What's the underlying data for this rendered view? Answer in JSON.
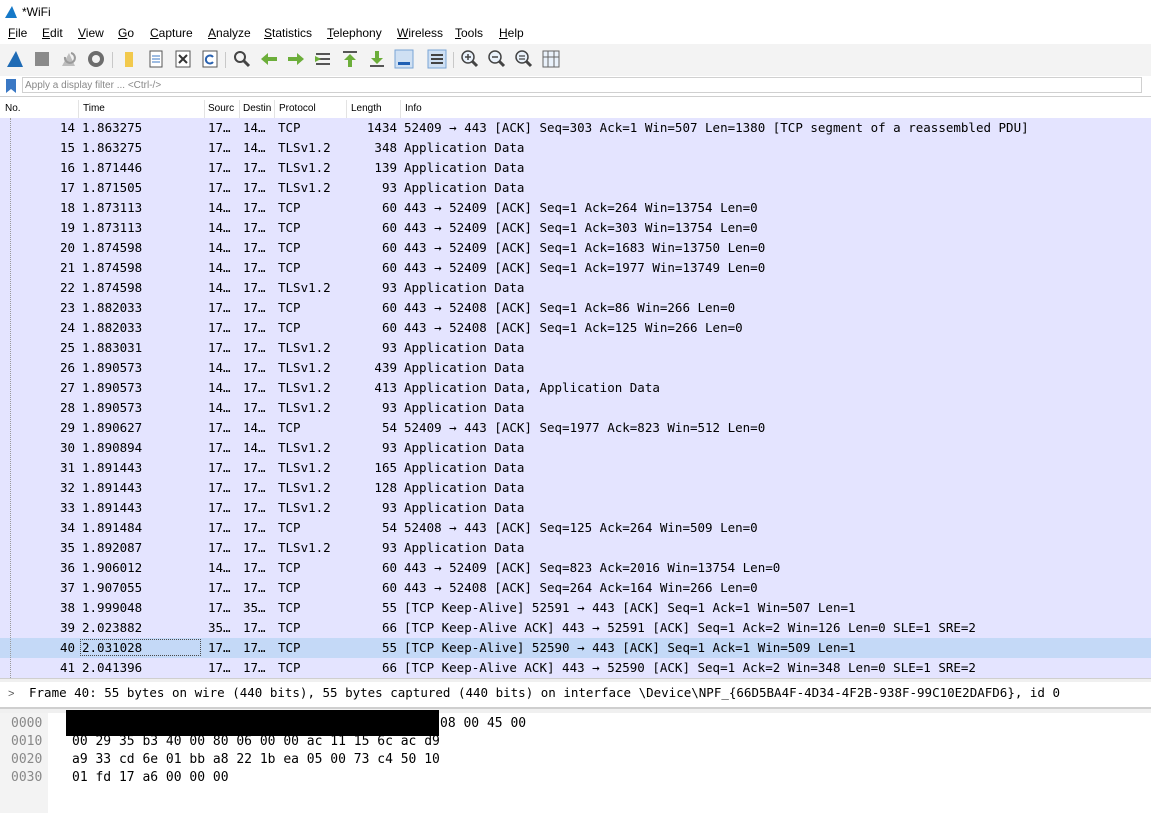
{
  "window": {
    "title": "*WiFi"
  },
  "menu": [
    "File",
    "Edit",
    "View",
    "Go",
    "Capture",
    "Analyze",
    "Statistics",
    "Telephony",
    "Wireless",
    "Tools",
    "Help"
  ],
  "toolbar_icons": [
    "shark-fin-start-icon",
    "stop-capture-icon",
    "restart-capture-icon",
    "capture-options-icon",
    "open-file-icon",
    "save-file-icon",
    "close-file-icon",
    "reload-file-icon",
    "find-packet-icon",
    "go-back-icon",
    "go-forward-icon",
    "go-to-packet-icon",
    "go-first-icon",
    "go-last-icon",
    "autoscroll-icon",
    "colorize-icon",
    "zoom-in-icon",
    "zoom-out-icon",
    "zoom-normal-icon",
    "resize-columns-icon"
  ],
  "filter": {
    "placeholder": "Apply a display filter ... <Ctrl-/>"
  },
  "columns": [
    "No.",
    "Time",
    "Sourc",
    "Destin",
    "Protocol",
    "Length",
    "Info"
  ],
  "packets": [
    {
      "no": "14",
      "time": "1.863275",
      "src": "17…",
      "dst": "14…",
      "proto": "TCP",
      "len": "1434",
      "info": "52409 → 443 [ACK] Seq=303 Ack=1 Win=507 Len=1380 [TCP segment of a reassembled PDU]"
    },
    {
      "no": "15",
      "time": "1.863275",
      "src": "17…",
      "dst": "14…",
      "proto": "TLSv1.2",
      "len": "348",
      "info": "Application Data"
    },
    {
      "no": "16",
      "time": "1.871446",
      "src": "17…",
      "dst": "17…",
      "proto": "TLSv1.2",
      "len": "139",
      "info": "Application Data"
    },
    {
      "no": "17",
      "time": "1.871505",
      "src": "17…",
      "dst": "17…",
      "proto": "TLSv1.2",
      "len": "93",
      "info": "Application Data"
    },
    {
      "no": "18",
      "time": "1.873113",
      "src": "14…",
      "dst": "17…",
      "proto": "TCP",
      "len": "60",
      "info": "443 → 52409 [ACK] Seq=1 Ack=264 Win=13754 Len=0"
    },
    {
      "no": "19",
      "time": "1.873113",
      "src": "14…",
      "dst": "17…",
      "proto": "TCP",
      "len": "60",
      "info": "443 → 52409 [ACK] Seq=1 Ack=303 Win=13754 Len=0"
    },
    {
      "no": "20",
      "time": "1.874598",
      "src": "14…",
      "dst": "17…",
      "proto": "TCP",
      "len": "60",
      "info": "443 → 52409 [ACK] Seq=1 Ack=1683 Win=13750 Len=0"
    },
    {
      "no": "21",
      "time": "1.874598",
      "src": "14…",
      "dst": "17…",
      "proto": "TCP",
      "len": "60",
      "info": "443 → 52409 [ACK] Seq=1 Ack=1977 Win=13749 Len=0"
    },
    {
      "no": "22",
      "time": "1.874598",
      "src": "14…",
      "dst": "17…",
      "proto": "TLSv1.2",
      "len": "93",
      "info": "Application Data"
    },
    {
      "no": "23",
      "time": "1.882033",
      "src": "17…",
      "dst": "17…",
      "proto": "TCP",
      "len": "60",
      "info": "443 → 52408 [ACK] Seq=1 Ack=86 Win=266 Len=0"
    },
    {
      "no": "24",
      "time": "1.882033",
      "src": "17…",
      "dst": "17…",
      "proto": "TCP",
      "len": "60",
      "info": "443 → 52408 [ACK] Seq=1 Ack=125 Win=266 Len=0"
    },
    {
      "no": "25",
      "time": "1.883031",
      "src": "17…",
      "dst": "17…",
      "proto": "TLSv1.2",
      "len": "93",
      "info": "Application Data"
    },
    {
      "no": "26",
      "time": "1.890573",
      "src": "14…",
      "dst": "17…",
      "proto": "TLSv1.2",
      "len": "439",
      "info": "Application Data"
    },
    {
      "no": "27",
      "time": "1.890573",
      "src": "14…",
      "dst": "17…",
      "proto": "TLSv1.2",
      "len": "413",
      "info": "Application Data, Application Data"
    },
    {
      "no": "28",
      "time": "1.890573",
      "src": "14…",
      "dst": "17…",
      "proto": "TLSv1.2",
      "len": "93",
      "info": "Application Data"
    },
    {
      "no": "29",
      "time": "1.890627",
      "src": "17…",
      "dst": "14…",
      "proto": "TCP",
      "len": "54",
      "info": "52409 → 443 [ACK] Seq=1977 Ack=823 Win=512 Len=0"
    },
    {
      "no": "30",
      "time": "1.890894",
      "src": "17…",
      "dst": "14…",
      "proto": "TLSv1.2",
      "len": "93",
      "info": "Application Data"
    },
    {
      "no": "31",
      "time": "1.891443",
      "src": "17…",
      "dst": "17…",
      "proto": "TLSv1.2",
      "len": "165",
      "info": "Application Data"
    },
    {
      "no": "32",
      "time": "1.891443",
      "src": "17…",
      "dst": "17…",
      "proto": "TLSv1.2",
      "len": "128",
      "info": "Application Data"
    },
    {
      "no": "33",
      "time": "1.891443",
      "src": "17…",
      "dst": "17…",
      "proto": "TLSv1.2",
      "len": "93",
      "info": "Application Data"
    },
    {
      "no": "34",
      "time": "1.891484",
      "src": "17…",
      "dst": "17…",
      "proto": "TCP",
      "len": "54",
      "info": "52408 → 443 [ACK] Seq=125 Ack=264 Win=509 Len=0"
    },
    {
      "no": "35",
      "time": "1.892087",
      "src": "17…",
      "dst": "17…",
      "proto": "TLSv1.2",
      "len": "93",
      "info": "Application Data"
    },
    {
      "no": "36",
      "time": "1.906012",
      "src": "14…",
      "dst": "17…",
      "proto": "TCP",
      "len": "60",
      "info": "443 → 52409 [ACK] Seq=823 Ack=2016 Win=13754 Len=0"
    },
    {
      "no": "37",
      "time": "1.907055",
      "src": "17…",
      "dst": "17…",
      "proto": "TCP",
      "len": "60",
      "info": "443 → 52408 [ACK] Seq=264 Ack=164 Win=266 Len=0"
    },
    {
      "no": "38",
      "time": "1.999048",
      "src": "17…",
      "dst": "35…",
      "proto": "TCP",
      "len": "55",
      "info": "[TCP Keep-Alive] 52591 → 443 [ACK] Seq=1 Ack=1 Win=507 Len=1"
    },
    {
      "no": "39",
      "time": "2.023882",
      "src": "35…",
      "dst": "17…",
      "proto": "TCP",
      "len": "66",
      "info": "[TCP Keep-Alive ACK] 443 → 52591 [ACK] Seq=1 Ack=2 Win=126 Len=0 SLE=1 SRE=2"
    },
    {
      "no": "40",
      "time": "2.031028",
      "src": "17…",
      "dst": "17…",
      "proto": "TCP",
      "len": "55",
      "info": "[TCP Keep-Alive] 52590 → 443 [ACK] Seq=1 Ack=1 Win=509 Len=1",
      "selected": true
    },
    {
      "no": "41",
      "time": "2.041396",
      "src": "17…",
      "dst": "17…",
      "proto": "TCP",
      "len": "66",
      "info": "[TCP Keep-Alive ACK] 443 → 52590 [ACK] Seq=1 Ack=2 Win=348 Len=0 SLE=1 SRE=2"
    }
  ],
  "details": {
    "frame_summary": "Frame 40: 55 bytes on wire (440 bits), 55 bytes captured (440 bits) on interface \\Device\\NPF_{66D5BA4F-4D34-4F2B-938F-99C10E2DAFD6}, id 0"
  },
  "bytes": [
    {
      "offset": "0000",
      "hex": "08 00 45 00"
    },
    {
      "offset": "0010",
      "hex": "00 29 35 b3 40 00 80 06  00 00 ac 11 15 6c ac d9"
    },
    {
      "offset": "0020",
      "hex": "a9 33 cd 6e 01 bb a8 22  1b ea 05 00 73 c4 50 10"
    },
    {
      "offset": "0030",
      "hex": "01 fd 17 a6 00 00 00"
    }
  ],
  "colors": {
    "packet_row_bg": "#e4e4ff",
    "selected_row_bg": "#c4d9f7",
    "toolbar_bg": "#f3f3f3"
  }
}
